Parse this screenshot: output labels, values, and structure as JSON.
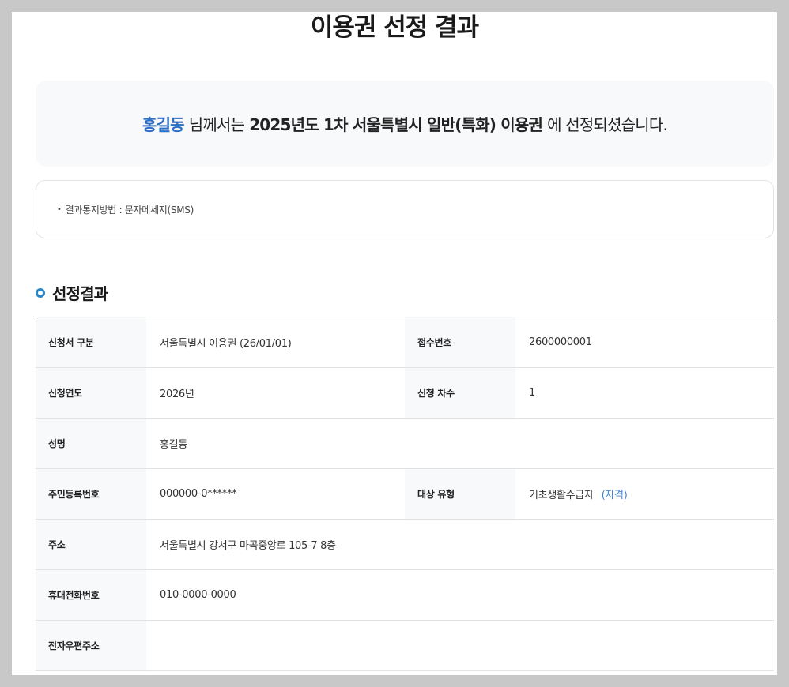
{
  "page": {
    "title": "이용권 선정 결과"
  },
  "notice": {
    "name": "홍길동",
    "text_mid": "님께서는",
    "voucher": "2025년도 1차 서울특별시 일반(특화) 이용권",
    "text_end": "에 선정되셨습니다."
  },
  "info": {
    "bullet": "•",
    "method_label": "결과통지방법 : 문자메세지(SMS)"
  },
  "section": {
    "title": "선정결과"
  },
  "result": {
    "application_type_label": "신청서 구분",
    "application_type_value": "서울특별시 이용권 (26/01/01)",
    "receipt_no_label": "접수번호",
    "receipt_no_value": "2600000001",
    "year_label": "신청연도",
    "year_value": "2026년",
    "round_label": "신청 차수",
    "round_value": "1",
    "name_label": "성명",
    "name_value": "홍길동",
    "rrn_label": "주민등록번호",
    "rrn_value": "000000-0******",
    "target_type_label": "대상 유형",
    "target_type_value": "기초생활수급자",
    "target_type_link": "(자격)",
    "address_label": "주소",
    "address_value": "서울특별시 강서구 마곡중앙로 105-7 8층",
    "phone_label": "휴대전화번호",
    "phone_value": "010-0000-0000",
    "email_label": "전자우편주소",
    "email_value": ""
  },
  "colors": {
    "accent_blue": "#2f6fc6",
    "link_blue": "#3d86d6",
    "section_ring": "#2a86c9"
  }
}
